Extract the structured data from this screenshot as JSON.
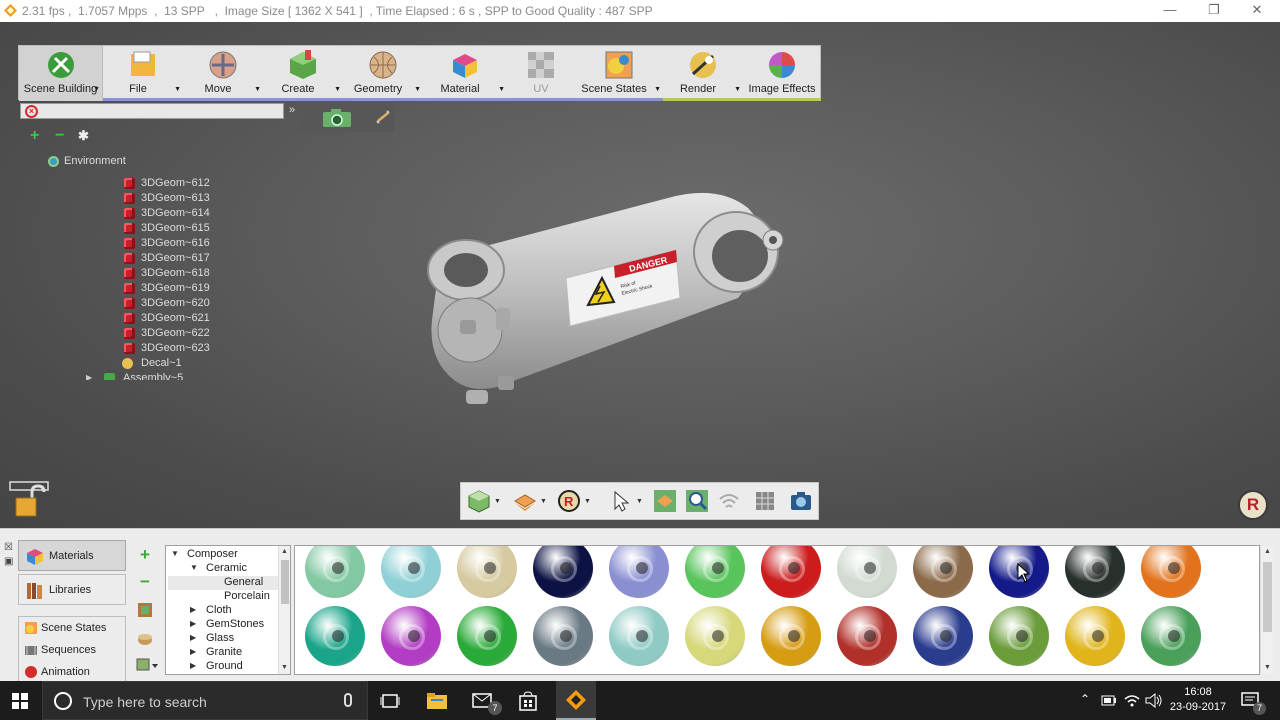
{
  "window": {
    "title": "2.31 fps ,  1.7057 Mpps  ,  13 SPP   ,  Image Size [ 1362 X 541 ]  , Time Elapsed : 6 s , SPP to Good Quality : 487 SPP"
  },
  "ribbon": {
    "items": [
      {
        "label": "Scene Building",
        "icon": "scene-building-icon"
      },
      {
        "label": "File",
        "icon": "file-icon"
      },
      {
        "label": "Move",
        "icon": "move-icon"
      },
      {
        "label": "Create",
        "icon": "create-icon"
      },
      {
        "label": "Geometry",
        "icon": "geometry-icon"
      },
      {
        "label": "Material",
        "icon": "material-icon"
      },
      {
        "label": "UV",
        "icon": "uv-icon"
      },
      {
        "label": "Scene States",
        "icon": "scene-states-icon"
      },
      {
        "label": "Render",
        "icon": "render-icon"
      },
      {
        "label": "Image Effects",
        "icon": "image-effects-icon"
      }
    ]
  },
  "scene_tree": {
    "root": "Environment",
    "items": [
      "3DGeom~612",
      "3DGeom~613",
      "3DGeom~614",
      "3DGeom~615",
      "3DGeom~616",
      "3DGeom~617",
      "3DGeom~618",
      "3DGeom~619",
      "3DGeom~620",
      "3DGeom~621",
      "3DGeom~622",
      "3DGeom~623"
    ],
    "decal": "Decal~1",
    "assembly": "Assembly~5"
  },
  "viewport": {
    "warning_label": {
      "header": "DANGER",
      "line1": "Risk of",
      "line2": "Electric Shock"
    },
    "logo_letter": "R"
  },
  "dock": {
    "nav": {
      "materials": "Materials",
      "libraries": "Libraries",
      "scene_states": "Scene States",
      "sequences": "Sequences",
      "animation": "Animation"
    },
    "library_tree": {
      "composer": "Composer",
      "ceramic": "Ceramic",
      "general": "General",
      "porcelain": "Porcelain",
      "cloth": "Cloth",
      "gemstones": "GemStones",
      "glass": "Glass",
      "granite": "Granite",
      "ground": "Ground"
    },
    "swatch_colors": [
      [
        "#82c8a2",
        "#8fd0d6",
        "#d6caa0",
        "#0c1344",
        "#8a8fd2",
        "#58c45c",
        "#cc1c1c",
        "#d2dad2",
        "#8b6a4a",
        "#141a8a",
        "#28302c",
        "#e2731c"
      ],
      [
        "#1aa58a",
        "#b23cc4",
        "#2aaa38",
        "#6a7a84",
        "#8fcac4",
        "#d6d87a",
        "#d69c12",
        "#b2302a",
        "#2a3c8e",
        "#6a9c3a",
        "#e0b41a",
        "#4aa05a"
      ]
    ]
  },
  "taskbar": {
    "search_placeholder": "Type here to search",
    "time": "16:08",
    "date": "23-09-2017",
    "mail_badge": "7",
    "notification_badge": "7"
  }
}
